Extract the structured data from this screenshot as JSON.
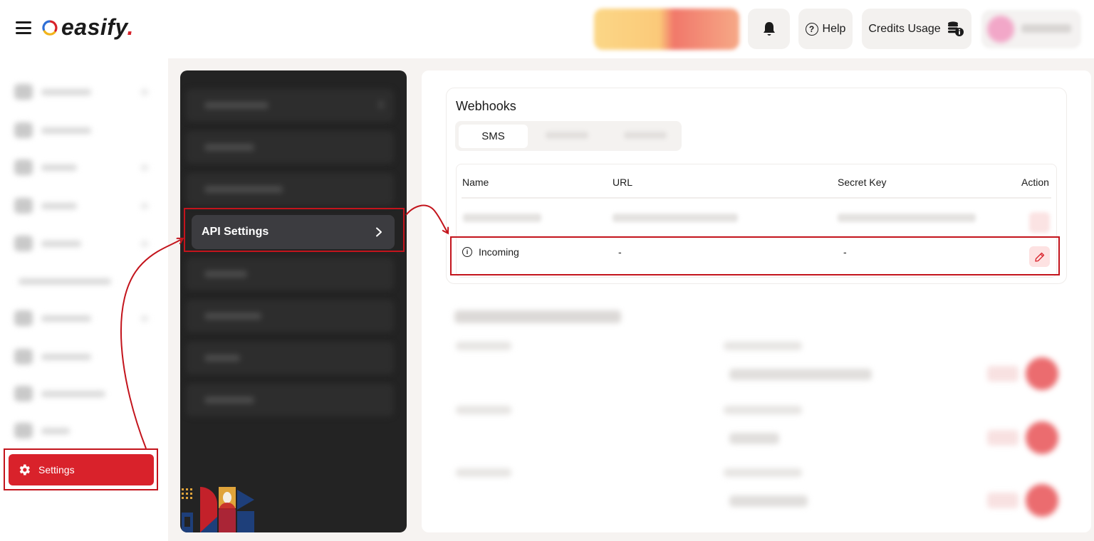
{
  "header": {
    "brand": "easify",
    "brand_dot": ".",
    "help_label": "Help",
    "credits_label": "Credits Usage"
  },
  "sidebar": {
    "settings_label": "Settings"
  },
  "settings_menu": {
    "api_settings_label": "API Settings"
  },
  "webhooks": {
    "title": "Webhooks",
    "tabs": [
      {
        "label": "SMS",
        "active": true
      }
    ],
    "columns": [
      "Name",
      "URL",
      "Secret Key",
      "Action"
    ],
    "incoming_row": {
      "name": "Incoming",
      "url": "-",
      "secret_key": "-"
    }
  },
  "colors": {
    "accent": "#d9222b",
    "annotation": "#c3141c",
    "dark_panel": "#232323"
  },
  "icons": [
    "hamburger-icon",
    "bell-icon",
    "help-icon",
    "credits-icon",
    "gear-icon",
    "chevron-right-icon",
    "info-icon",
    "pencil-icon"
  ]
}
